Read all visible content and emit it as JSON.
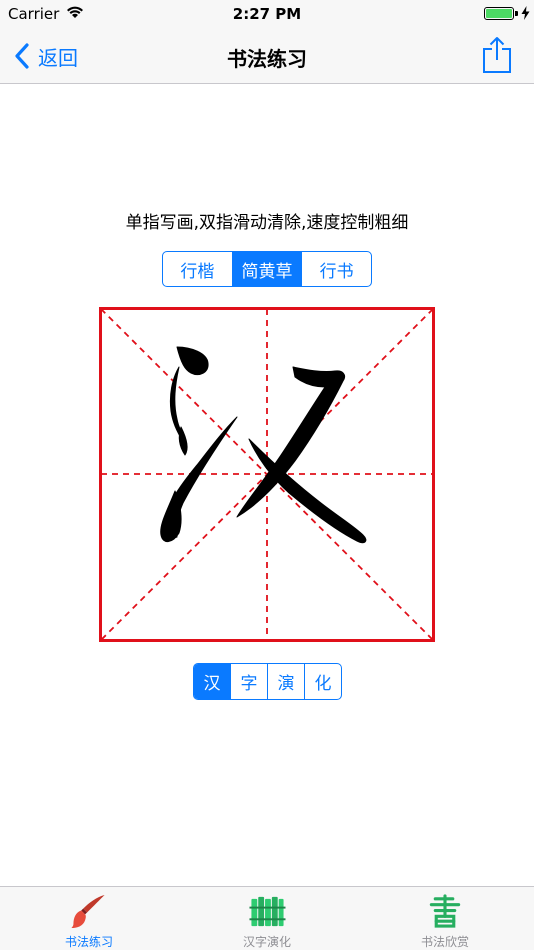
{
  "status_bar": {
    "carrier": "Carrier",
    "time": "2:27 PM",
    "battery_color": "#4cd964"
  },
  "nav": {
    "back_label": "返回",
    "title": "书法练习",
    "back_icon": "chevron-left-icon",
    "share_icon": "share-icon"
  },
  "instructions": "单指写画,双指滑动清除,速度控制粗细",
  "style_segments": [
    {
      "label": "行楷",
      "selected": false
    },
    {
      "label": "简黄草",
      "selected": true
    },
    {
      "label": "行书",
      "selected": false
    }
  ],
  "practice_grid": {
    "character": "汉",
    "border_color": "#e0101a",
    "guide_color": "#e0101a"
  },
  "char_segments": [
    {
      "label": "汉",
      "selected": true
    },
    {
      "label": "字",
      "selected": false
    },
    {
      "label": "演",
      "selected": false
    },
    {
      "label": "化",
      "selected": false
    }
  ],
  "tabs": [
    {
      "label": "书法练习",
      "icon": "brush-icon",
      "active": true
    },
    {
      "label": "汉字演化",
      "icon": "bamboo-slips-icon",
      "active": false
    },
    {
      "label": "书法欣赏",
      "icon": "calligraphy-shu-icon",
      "active": false
    }
  ],
  "colors": {
    "accent": "#0a7aff",
    "tab_inactive": "#8e8e93"
  }
}
